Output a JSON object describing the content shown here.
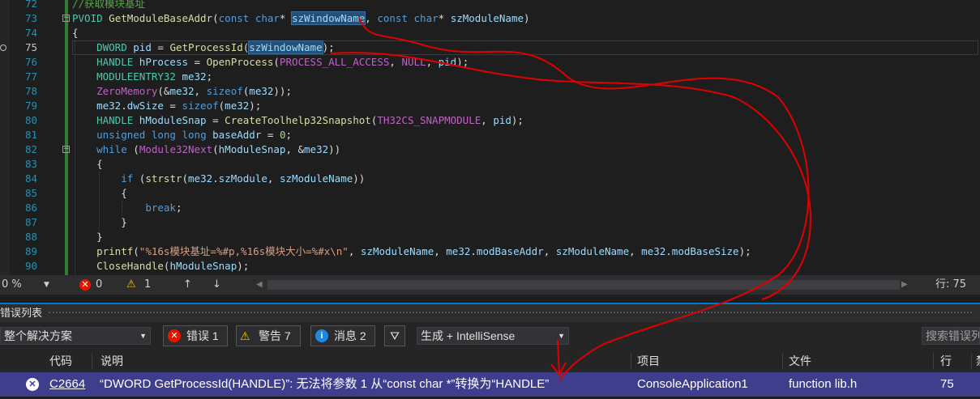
{
  "editor": {
    "lines": [
      {
        "num": "72",
        "html": "<span class='c'>//获取模块基址</span>"
      },
      {
        "num": "73",
        "html": "<span class='t'>PVOID</span> <span class='f'>GetModuleBaseAddr</span>(<span class='k'>const</span> <span class='k'>char</span>* <span class='p hl'>szWindowName</span>, <span class='k'>const</span> <span class='k'>char</span>* <span class='p'>szModuleName</span>)"
      },
      {
        "num": "74",
        "html": "{"
      },
      {
        "num": "75",
        "html": "    <span class='t'>DWORD</span> <span class='v'>pid</span> = <span class='f'>GetProcessId</span>(<span class='p hl'>szWindowName</span>);"
      },
      {
        "num": "76",
        "html": "    <span class='t'>HANDLE</span> <span class='v'>hProcess</span> = <span class='f'>OpenProcess</span>(<span class='m'>PROCESS_ALL_ACCESS</span>, <span class='m'>NULL</span>, <span class='v'>pid</span>);"
      },
      {
        "num": "77",
        "html": "    <span class='t'>MODULEENTRY32</span> <span class='v'>me32</span>;"
      },
      {
        "num": "78",
        "html": "    <span class='m'>ZeroMemory</span>(&amp;<span class='v'>me32</span>, <span class='k'>sizeof</span>(<span class='v'>me32</span>));"
      },
      {
        "num": "79",
        "html": "    <span class='v'>me32</span>.<span class='v'>dwSize</span> = <span class='k'>sizeof</span>(<span class='v'>me32</span>);"
      },
      {
        "num": "80",
        "html": "    <span class='t'>HANDLE</span> <span class='v'>hModuleSnap</span> = <span class='f'>CreateToolhelp32Snapshot</span>(<span class='m'>TH32CS_SNAPMODULE</span>, <span class='v'>pid</span>);"
      },
      {
        "num": "81",
        "html": "    <span class='k'>unsigned</span> <span class='k'>long</span> <span class='k'>long</span> <span class='v'>baseAddr</span> = <span class='n'>0</span>;"
      },
      {
        "num": "82",
        "html": "    <span class='k'>while</span> (<span class='m'>Module32Next</span>(<span class='v'>hModuleSnap</span>, &amp;<span class='v'>me32</span>))"
      },
      {
        "num": "83",
        "html": "    {"
      },
      {
        "num": "84",
        "html": "        <span class='k'>if</span> (<span class='f'>strstr</span>(<span class='v'>me32</span>.<span class='v'>szModule</span>, <span class='p'>szModuleName</span>))"
      },
      {
        "num": "85",
        "html": "        {"
      },
      {
        "num": "86",
        "html": "            <span class='k'>break</span>;"
      },
      {
        "num": "87",
        "html": "        }"
      },
      {
        "num": "88",
        "html": "    }"
      },
      {
        "num": "89",
        "html": "    <span class='f'>printf</span>(<span class='s'>\"%16s模块基址=%#p,%16s模块大小=%#x\\n\"</span>, <span class='p'>szModuleName</span>, <span class='v'>me32</span>.<span class='v'>modBaseAddr</span>, <span class='p'>szModuleName</span>, <span class='v'>me32</span>.<span class='v'>modBaseSize</span>);"
      },
      {
        "num": "90",
        "html": "    <span class='f'>CloseHandle</span>(<span class='v'>hModuleSnap</span>);"
      }
    ]
  },
  "statusbar": {
    "zoom": "0 %",
    "errors": "0",
    "warnings": "1",
    "line_label": "行: 75"
  },
  "error_list": {
    "title": "错误列表",
    "scope": "整个解决方案",
    "errors_btn": "错误 1",
    "warnings_btn": "警告 7",
    "messages_btn": "消息 2",
    "build_filter": "生成 + IntelliSense",
    "search_placeholder": "搜索错误列",
    "columns": {
      "code": "代码",
      "desc": "说明",
      "project": "项目",
      "file": "文件",
      "line": "行",
      "extra": "禁"
    },
    "rows": [
      {
        "code": "C2664",
        "desc": "“DWORD GetProcessId(HANDLE)”: 无法将参数 1 从“const char *”转换为“HANDLE”",
        "project": "ConsoleApplication1",
        "file": "function lib.h",
        "line": "75"
      }
    ]
  },
  "colors": {
    "annotation": "#e00000",
    "selected_row": "#3e3e8c",
    "accent": "#007acc"
  }
}
